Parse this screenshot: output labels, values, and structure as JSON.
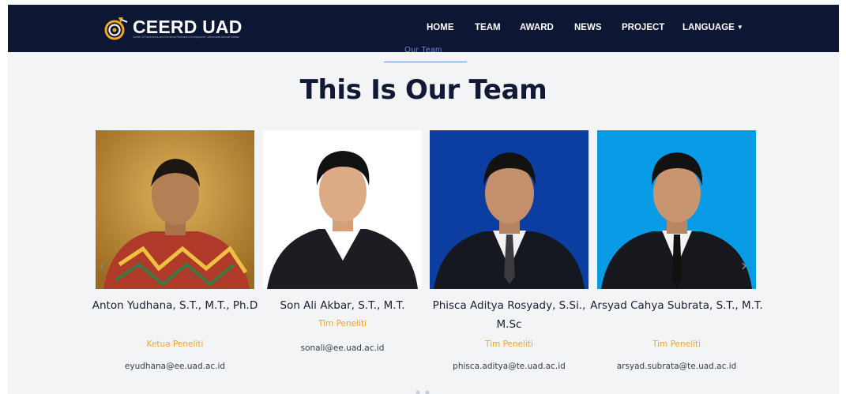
{
  "brand": {
    "title": "CEERD UAD",
    "subtitle": "Center of Electronics and Electrical Research Development, Universitas Ahmad Dahlan",
    "accent": "#f5a623",
    "nav_bg": "#0d1633"
  },
  "nav": {
    "home": "HOME",
    "team": "TEAM",
    "award": "AWARD",
    "news": "NEWS",
    "project": "PROJECT",
    "language": "LANGUAGE"
  },
  "section": {
    "label": "Our Team",
    "heading": "This Is Our Team"
  },
  "team": [
    {
      "name": "Anton Yudhana, S.T., M.T., Ph.D",
      "role": "Ketua Peneliti",
      "email": "eyudhana@ee.uad.ac.id"
    },
    {
      "name": "Son Ali Akbar, S.T., M.T.",
      "role": "Tim Peneliti",
      "email": "sonali@ee.uad.ac.id"
    },
    {
      "name": "Phisca Aditya Rosyady, S.Si., M.Sc",
      "role": "Tim Peneliti",
      "email": "phisca.aditya@te.uad.ac.id"
    },
    {
      "name": "Arsyad Cahya Subrata, S.T., M.T.",
      "role": "Tim Peneliti",
      "email": "arsyad.subrata@te.uad.ac.id"
    }
  ],
  "icons": {
    "prev": "chevron-left-icon",
    "next": "chevron-right-icon",
    "dropdown": "caret-down-icon"
  }
}
